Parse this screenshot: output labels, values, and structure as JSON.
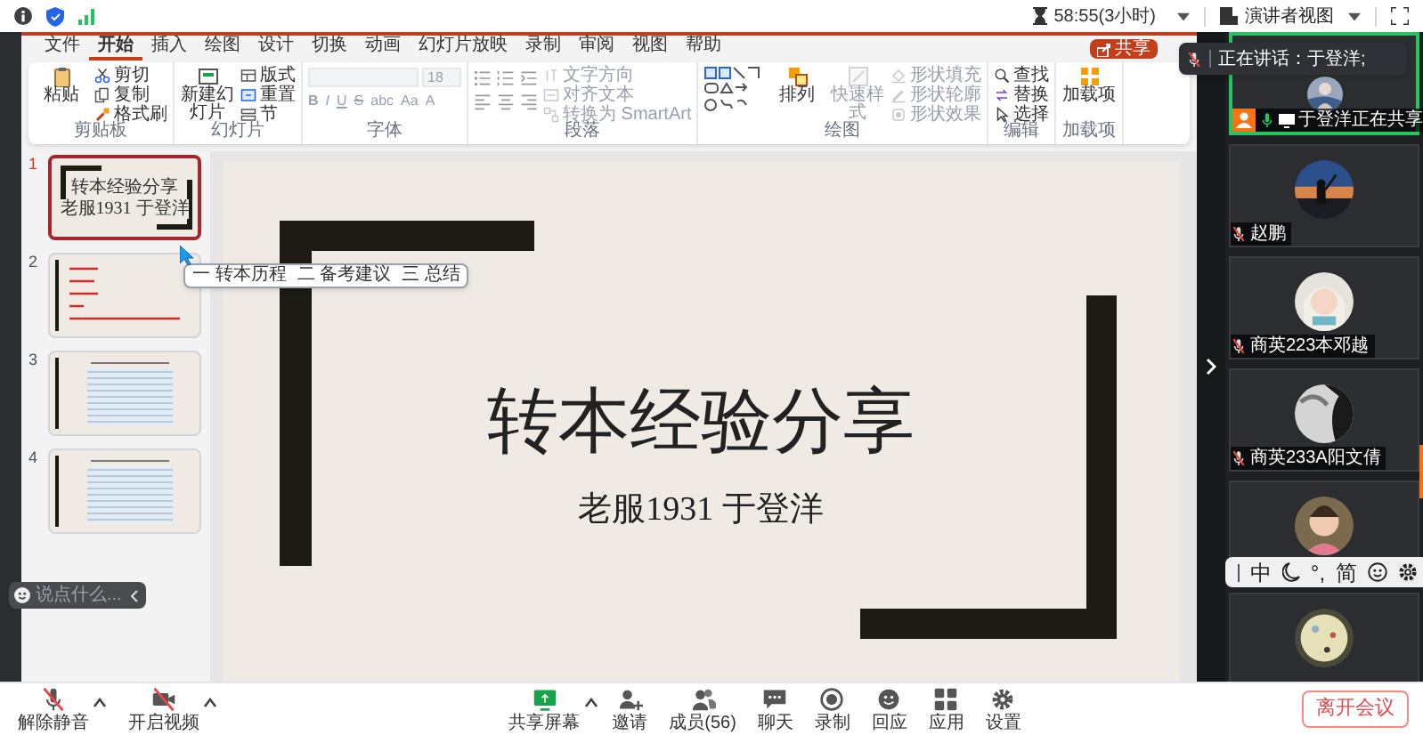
{
  "top_bar": {
    "timer": "58:55(3小时)",
    "view_button": "演讲者视图"
  },
  "ribbon_tabs": [
    {
      "label": "文件",
      "selected": false
    },
    {
      "label": "开始",
      "selected": true
    },
    {
      "label": "插入",
      "selected": false
    },
    {
      "label": "绘图",
      "selected": false
    },
    {
      "label": "设计",
      "selected": false
    },
    {
      "label": "切换",
      "selected": false
    },
    {
      "label": "动画",
      "selected": false
    },
    {
      "label": "幻灯片放映",
      "selected": false
    },
    {
      "label": "录制",
      "selected": false
    },
    {
      "label": "审阅",
      "selected": false
    },
    {
      "label": "视图",
      "selected": false
    },
    {
      "label": "帮助",
      "selected": false
    }
  ],
  "share_button": "共享",
  "ribbon_groups": [
    {
      "label": "剪贴板",
      "kind": "commands",
      "large": [
        {
          "label": "粘贴",
          "disabled": false
        }
      ],
      "small": [
        {
          "label": "剪切",
          "disabled": false
        },
        {
          "label": "复制",
          "disabled": false
        },
        {
          "label": "格式刷",
          "disabled": false
        }
      ]
    },
    {
      "label": "幻灯片",
      "kind": "commands",
      "large": [
        {
          "label": "新建幻灯片",
          "disabled": false
        }
      ],
      "small": [
        {
          "label": "版式",
          "disabled": false
        },
        {
          "label": "重置",
          "disabled": false
        },
        {
          "label": "节",
          "disabled": false
        }
      ]
    },
    {
      "label": "字体",
      "kind": "font",
      "font_size": "18",
      "tools": [
        "B",
        "I",
        "U",
        "S",
        "abc",
        "Aa",
        "A"
      ]
    },
    {
      "label": "段落",
      "kind": "paragraph",
      "small": [
        {
          "label": "文字方向",
          "disabled": true
        },
        {
          "label": "对齐文本",
          "disabled": true
        },
        {
          "label": "转换为 SmartArt",
          "disabled": true
        }
      ]
    },
    {
      "label": "绘图",
      "kind": "drawing",
      "large": [
        {
          "label": "排列",
          "disabled": false
        },
        {
          "label": "快速样式",
          "disabled": true
        }
      ],
      "small": [
        {
          "label": "形状填充",
          "disabled": true
        },
        {
          "label": "形状轮廓",
          "disabled": true
        },
        {
          "label": "形状效果",
          "disabled": true
        }
      ]
    },
    {
      "label": "编辑",
      "kind": "commands",
      "small": [
        {
          "label": "查找",
          "disabled": false
        },
        {
          "label": "替换",
          "disabled": false
        },
        {
          "label": "选择",
          "disabled": false
        }
      ]
    },
    {
      "label": "加载项",
      "kind": "commands",
      "large": [
        {
          "label": "加载项",
          "disabled": false
        }
      ]
    }
  ],
  "slides": [
    {
      "number": "1",
      "selected": true,
      "kind": "title",
      "title": "转本经验分享",
      "subtitle": "老服1931 于登洋"
    },
    {
      "number": "2",
      "selected": false,
      "kind": "list"
    },
    {
      "number": "3",
      "selected": false,
      "kind": "table"
    },
    {
      "number": "4",
      "selected": false,
      "kind": "table"
    }
  ],
  "tooltip": [
    "一 转本历程",
    "二 备考建议",
    "三 总结"
  ],
  "slide": {
    "title": "转本经验分享",
    "subtitle": "老服1931 于登洋"
  },
  "chat": {
    "placeholder": "说点什么..."
  },
  "speaking_banner": "正在讲话：于登洋;",
  "participants": [
    {
      "name": "于登洋正在共享",
      "kind": "sharer",
      "active": true,
      "muted": false
    },
    {
      "name": "赵鹏",
      "kind": "member",
      "active": false,
      "muted": true
    },
    {
      "name": "商英223本邓越",
      "kind": "member",
      "active": false,
      "muted": true
    },
    {
      "name": "商英233A阳文倩",
      "kind": "member",
      "active": false,
      "muted": true
    },
    {
      "kind": "member",
      "active": false
    },
    {
      "kind": "member",
      "active": false
    }
  ],
  "ime_toolbar": {
    "mode": "中",
    "punctuation": "°,",
    "script": "简"
  },
  "bottom_bar": {
    "left": [
      {
        "label": "解除静音",
        "kind": "mic",
        "off": true
      },
      {
        "label": "开启视频",
        "kind": "camera",
        "off": true
      }
    ],
    "center": [
      {
        "label": "共享屏幕",
        "kind": "share"
      },
      {
        "label": "邀请",
        "kind": "invite"
      },
      {
        "label": "成员(56)",
        "kind": "members"
      },
      {
        "label": "聊天",
        "kind": "chat"
      },
      {
        "label": "录制",
        "kind": "record"
      },
      {
        "label": "回应",
        "kind": "react"
      },
      {
        "label": "应用",
        "kind": "apps"
      },
      {
        "label": "设置",
        "kind": "settings"
      }
    ],
    "leave_button": "离开会议"
  }
}
